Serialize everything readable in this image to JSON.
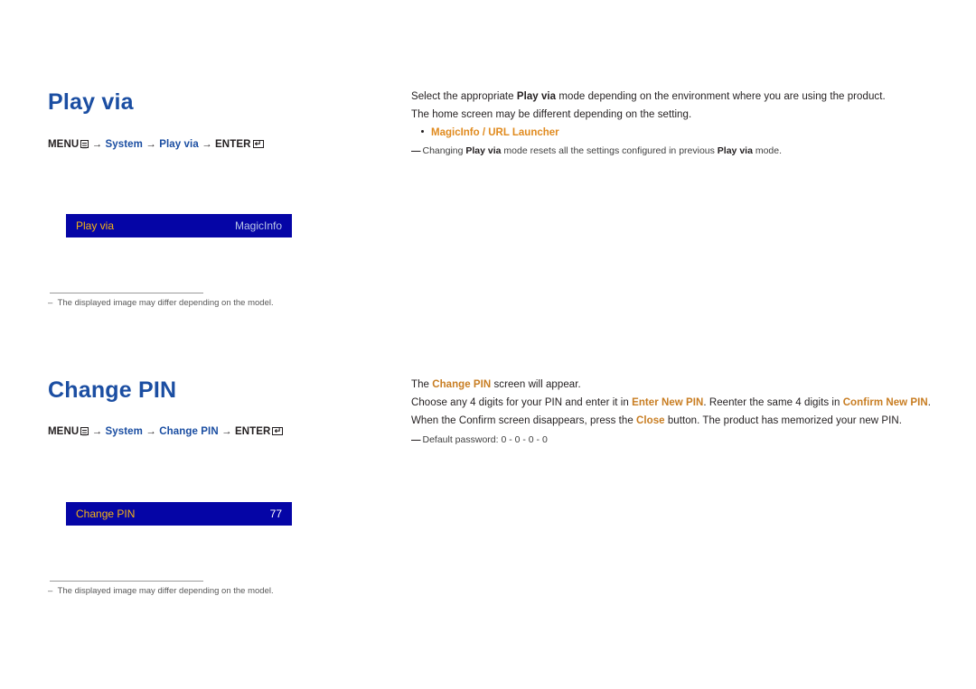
{
  "sections": [
    {
      "title": "Play via",
      "menu_path": {
        "prefix": "MENU",
        "items": [
          "System",
          "Play via"
        ],
        "enter": "ENTER"
      },
      "osd": {
        "label": "Play via",
        "value": "MagicInfo"
      },
      "footnote": "The displayed image may differ depending on the model.",
      "right": {
        "line1_a": "Select the appropriate ",
        "line1_b": "Play via",
        "line1_c": " mode depending on the environment where you are using the product.",
        "line2": "The home screen may be different depending on the setting.",
        "bullet": "MagicInfo / URL Launcher",
        "note_a": "Changing ",
        "note_b": "Play via",
        "note_c": " mode resets all the settings configured in previous ",
        "note_d": "Play via",
        "note_e": " mode."
      }
    },
    {
      "title": "Change PIN",
      "menu_path": {
        "prefix": "MENU",
        "items": [
          "System",
          "Change PIN"
        ],
        "enter": "ENTER"
      },
      "osd": {
        "label": "Change PIN",
        "value": "77"
      },
      "footnote": "The displayed image may differ depending on the model.",
      "right": {
        "line1_a": "The ",
        "line1_b": "Change PIN",
        "line1_c": " screen will appear.",
        "line2_a": "Choose any 4 digits for your PIN and enter it in ",
        "line2_b": "Enter New PIN",
        "line2_c": ". Reenter the same 4 digits in ",
        "line2_d": "Confirm New PIN",
        "line2_e": ".",
        "line3_a": "When the Confirm screen disappears, press the ",
        "line3_b": "Close",
        "line3_c": " button. The product has memorized your new PIN.",
        "note": "Default password: 0 - 0 - 0 - 0"
      }
    }
  ],
  "colors": {
    "heading_blue": "#1b4ea2",
    "osd_background": "#0505a6",
    "osd_label_yellow": "#f5b315",
    "accent_orange": "#c87d22"
  }
}
